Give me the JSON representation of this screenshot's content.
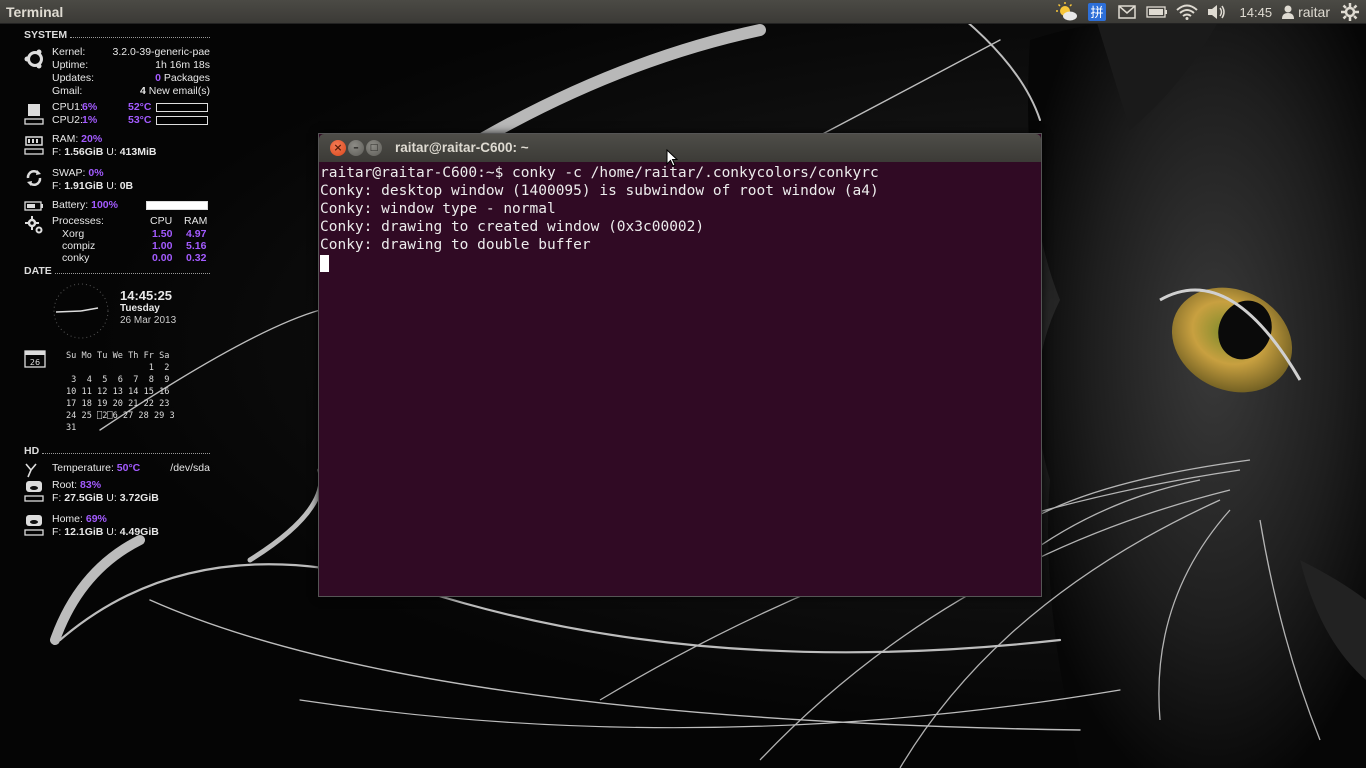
{
  "panel": {
    "app_title": "Terminal",
    "clock": "14:45",
    "user": "raitar",
    "icons": [
      "weather-icon",
      "keyboard-icon",
      "mail-icon",
      "battery-icon",
      "wifi-icon",
      "volume-icon",
      "user-icon",
      "gear-icon"
    ]
  },
  "conky": {
    "system": {
      "heading": "SYSTEM",
      "kernel_label": "Kernel:",
      "kernel_value": "3.2.0-39-generic-pae",
      "uptime_label": "Uptime:",
      "uptime_value": "1h 16m 18s",
      "updates_label": "Updates:",
      "updates_count": "0",
      "updates_unit": "Packages",
      "gmail_label": "Gmail:",
      "gmail_count": "4",
      "gmail_unit": "New email(s)",
      "cpu1_label": "CPU1:",
      "cpu1_pct": "6%",
      "cpu1_temp": "52°C",
      "cpu2_label": "CPU2:",
      "cpu2_pct": "1%",
      "cpu2_temp": "53°C",
      "ram_label": "RAM:",
      "ram_pct": "20%",
      "ram_free_label": "F:",
      "ram_free": "1.56GiB",
      "ram_used_label": "U:",
      "ram_used": "413MiB",
      "swap_label": "SWAP:",
      "swap_pct": "0%",
      "swap_free_label": "F:",
      "swap_free": "1.91GiB",
      "swap_used_label": "U:",
      "swap_used": "0B",
      "battery_label": "Battery:",
      "battery_pct": "100%",
      "battery_level": 1.0,
      "proc_label": "Processes:",
      "proc_cpu_head": "CPU",
      "proc_ram_head": "RAM",
      "processes": [
        {
          "name": "Xorg",
          "cpu": "1.50",
          "ram": "4.97"
        },
        {
          "name": "compiz",
          "cpu": "1.00",
          "ram": "5.16"
        },
        {
          "name": "conky",
          "cpu": "0.00",
          "ram": "0.32"
        }
      ]
    },
    "date": {
      "heading": "DATE",
      "time": "14:45:25",
      "weekday": "Tuesday",
      "date": "26 Mar 2013",
      "calendar_icon_day": "26",
      "calendar_rows": [
        "Su Mo Tu We Th Fr Sa",
        "                1  2",
        " 3  4  5  6  7  8  9",
        "10 11 12 13 14 15 16",
        "17 18 19 20 21 22 23",
        "24 25 ⎕2⎕6 27 28 29 3",
        "31"
      ]
    },
    "hd": {
      "heading": "HD",
      "temp_label": "Temperature:",
      "temp_value": "50°C",
      "device": "/dev/sda",
      "root_label": "Root:",
      "root_pct": "83%",
      "root_free_label": "F:",
      "root_free": "27.5GiB",
      "root_used_label": "U:",
      "root_used": "3.72GiB",
      "home_label": "Home:",
      "home_pct": "69%",
      "home_free_label": "F:",
      "home_free": "12.1GiB",
      "home_used_label": "U:",
      "home_used": "4.49GiB"
    }
  },
  "terminal": {
    "title": "raitar@raitar-C600: ~",
    "lines": [
      "raitar@raitar-C600:~$ conky -c /home/raitar/.conkycolors/conkyrc",
      "Conky: desktop window (1400095) is subwindow of root window (a4)",
      "Conky: window type - normal",
      "Conky: drawing to created window (0x3c00002)",
      "Conky: drawing to double buffer"
    ],
    "close_glyph": "×",
    "minimize_glyph": "–",
    "maximize_glyph": "□"
  },
  "colors": {
    "terminal_bg": "#300a24",
    "accent_purple": "#a35bff",
    "panel_bg": "#3c3b37",
    "close_orange": "#e2532a"
  }
}
